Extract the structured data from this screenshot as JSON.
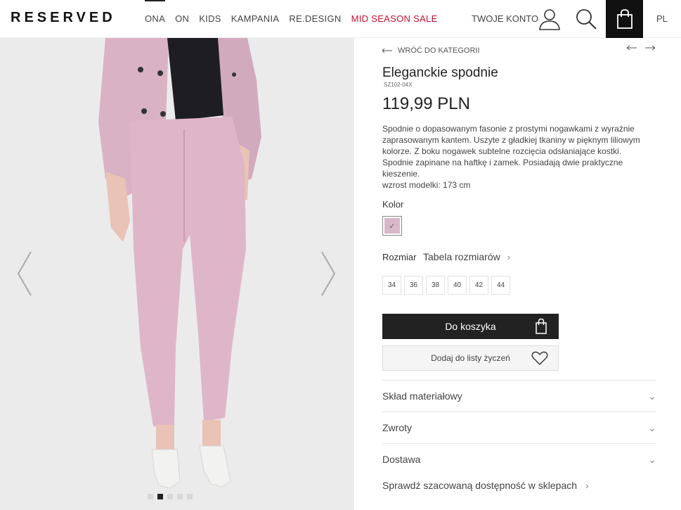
{
  "header": {
    "logo": "RESERVED",
    "nav": [
      {
        "label": "ONA",
        "active": true,
        "sale": false
      },
      {
        "label": "ON",
        "active": false,
        "sale": false
      },
      {
        "label": "KIDS",
        "active": false,
        "sale": false
      },
      {
        "label": "KAMPANIA",
        "active": false,
        "sale": false
      },
      {
        "label": "RE.DESIGN",
        "active": false,
        "sale": false
      },
      {
        "label": "MID SEASON SALE",
        "active": false,
        "sale": true
      }
    ],
    "account": "TWOJE KONTO",
    "language": "PL",
    "icons": [
      "user-icon",
      "search-icon",
      "shopping-bag-icon"
    ]
  },
  "gallery": {
    "image_count": 5,
    "active_index": 1,
    "colors": {
      "background": "#ebebeb",
      "jacket": "#d9b3c4",
      "trousers": "#dfb6c8",
      "top": "#1e1e22",
      "shoes": "#f2f2f0",
      "skin": "#e9c3b5"
    }
  },
  "product": {
    "back_label": "WRÓĆ DO KATEGORII",
    "title": "Eleganckie spodnie",
    "sku": "SZ102-04X",
    "price": "119,99 PLN",
    "description_lines": [
      "Spodnie o dopasowanym fasonie z prostymi nogawkami z wyraźnie",
      "zaprasowanym kantem. Uszyte z gładkiej tkaniny w pięknym liliowym",
      "kolorze. Z boku nogawek subtelne rozcięcia odsłaniające kostki.",
      "Spodnie zapinane na haftkę i zamek. Posiadają dwie praktyczne",
      "kieszenie.",
      "wzrost modelki: 173 cm"
    ],
    "color_label": "Kolor",
    "selected_color": "#d8b8c8",
    "size_label": "Rozmiar",
    "size_table_label": "Tabela rozmiarów",
    "sizes": [
      "34",
      "36",
      "38",
      "40",
      "42",
      "44"
    ],
    "add_to_cart": "Do koszyka",
    "add_to_wishlist": "Dodaj do listy życzeń",
    "accordions": [
      "Skład materiałowy",
      "Zwroty",
      "Dostawa"
    ],
    "availability": "Sprawdź szacowaną dostępność w sklepach"
  }
}
